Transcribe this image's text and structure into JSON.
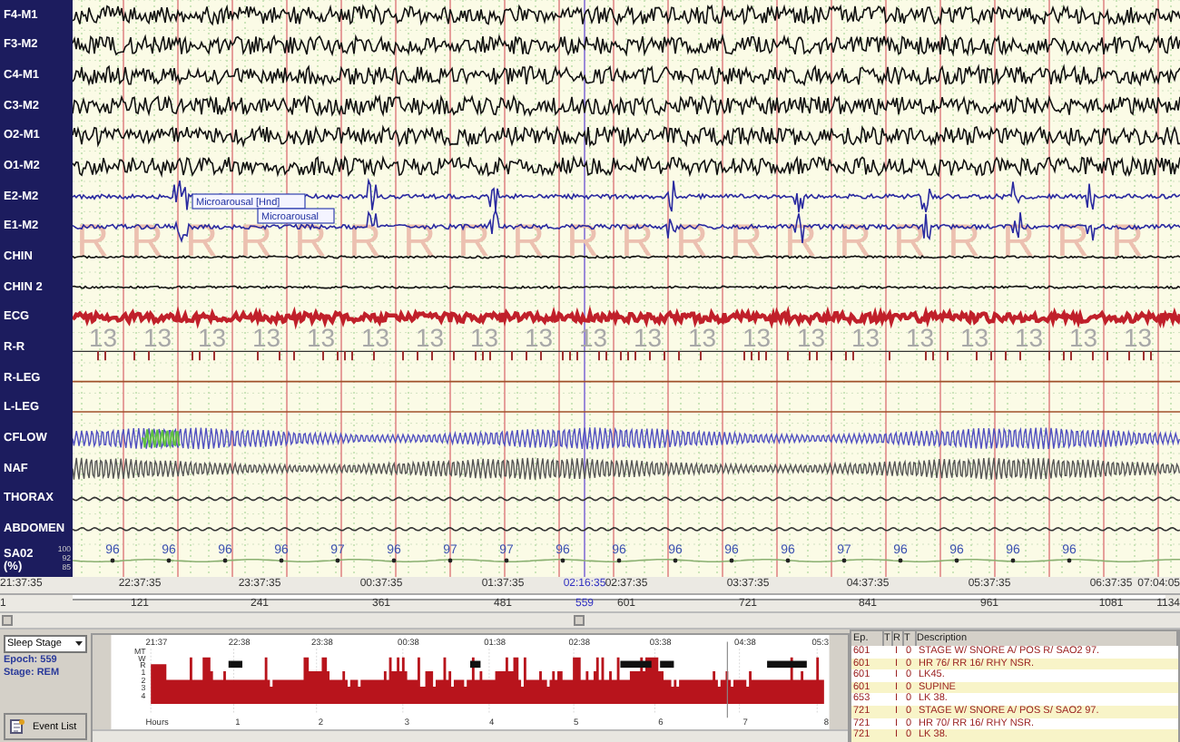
{
  "channels": [
    {
      "label": "F4-M1",
      "kind": "eeg"
    },
    {
      "label": "F3-M2",
      "kind": "eeg"
    },
    {
      "label": "C4-M1",
      "kind": "eeg"
    },
    {
      "label": "C3-M2",
      "kind": "eeg"
    },
    {
      "label": "O2-M1",
      "kind": "eeg"
    },
    {
      "label": "O1-M2",
      "kind": "eeg"
    },
    {
      "label": "E2-M2",
      "kind": "eog"
    },
    {
      "label": "E1-M2",
      "kind": "eog"
    },
    {
      "label": "CHIN",
      "kind": "emg"
    },
    {
      "label": "CHIN 2",
      "kind": "emg"
    },
    {
      "label": "ECG",
      "kind": "ecg"
    },
    {
      "label": "R-R",
      "kind": "rr"
    },
    {
      "label": "R-LEG",
      "kind": "leg"
    },
    {
      "label": "L-LEG",
      "kind": "leg"
    },
    {
      "label": "CFLOW",
      "kind": "flow"
    },
    {
      "label": "NAF",
      "kind": "naf"
    },
    {
      "label": "THORAX",
      "kind": "effort"
    },
    {
      "label": "ABDOMEN",
      "kind": "effort"
    },
    {
      "label": "SA02",
      "unit": "(%)",
      "kind": "spo2",
      "scale": [
        "100",
        "92",
        "85"
      ]
    }
  ],
  "epochs": [
    {
      "stage": "R",
      "rr": "13"
    },
    {
      "stage": "R",
      "rr": "13"
    },
    {
      "stage": "R",
      "rr": "13"
    },
    {
      "stage": "R",
      "rr": "13"
    },
    {
      "stage": "R",
      "rr": "13"
    },
    {
      "stage": "R",
      "rr": "13"
    },
    {
      "stage": "R",
      "rr": "13"
    },
    {
      "stage": "R",
      "rr": "13"
    },
    {
      "stage": "R",
      "rr": "13"
    },
    {
      "stage": "R",
      "rr": "13"
    },
    {
      "stage": "R",
      "rr": "13"
    },
    {
      "stage": "R",
      "rr": "13"
    },
    {
      "stage": "R",
      "rr": "13"
    },
    {
      "stage": "R",
      "rr": "13"
    },
    {
      "stage": "R",
      "rr": "13"
    },
    {
      "stage": "R",
      "rr": "13"
    },
    {
      "stage": "R",
      "rr": "13"
    },
    {
      "stage": "R",
      "rr": "13"
    },
    {
      "stage": "R",
      "rr": "13"
    },
    {
      "stage": "R",
      "rr": "13"
    }
  ],
  "spo2_values": [
    "96",
    "96",
    "96",
    "96",
    "97",
    "96",
    "97",
    "97",
    "96",
    "96",
    "96",
    "96",
    "96",
    "97",
    "96",
    "96",
    "96",
    "96"
  ],
  "events": [
    {
      "label": "Microarousal [Hnd]"
    },
    {
      "label": "Microarousal"
    }
  ],
  "time_axis": [
    {
      "time": "21:37:35",
      "epoch": "1",
      "selected": false
    },
    {
      "time": "22:37:35",
      "epoch": "121",
      "selected": false
    },
    {
      "time": "23:37:35",
      "epoch": "241",
      "selected": false
    },
    {
      "time": "00:37:35",
      "epoch": "361",
      "selected": false
    },
    {
      "time": "01:37:35",
      "epoch": "481",
      "selected": false
    },
    {
      "time": "02:16:35",
      "epoch": "559",
      "selected": true
    },
    {
      "time": "02:37:35",
      "epoch": "601",
      "selected": false
    },
    {
      "time": "03:37:35",
      "epoch": "721",
      "selected": false
    },
    {
      "time": "04:37:35",
      "epoch": "841",
      "selected": false
    },
    {
      "time": "05:37:35",
      "epoch": "961",
      "selected": false
    },
    {
      "time": "06:37:35",
      "epoch": "1081",
      "selected": false
    },
    {
      "time": "07:04:05",
      "epoch": "1134",
      "selected": false
    }
  ],
  "sidebar": {
    "dropdown": "Sleep Stage",
    "epoch": "Epoch: 559",
    "stage": "Stage: REM",
    "event_list_button": "Event List"
  },
  "hypnogram": {
    "stage_labels": [
      "MT",
      "W",
      "R",
      "1",
      "2",
      "3",
      "4"
    ],
    "clock_labels": [
      "21:37",
      "22:38",
      "23:38",
      "00:38",
      "01:38",
      "02:38",
      "03:38",
      "04:38",
      "05:3"
    ],
    "hours_label": "Hours",
    "hours": [
      "1",
      "2",
      "3",
      "4",
      "5",
      "6",
      "7",
      "8"
    ]
  },
  "event_table": {
    "columns": [
      "Ep.",
      "T",
      "R",
      "T",
      "Description"
    ],
    "rows": [
      {
        "ep": "601",
        "flag": "I",
        "value": "0",
        "description": "STAGE W/ SNORE A/ POS R/ SAO2 97."
      },
      {
        "ep": "601",
        "flag": "I",
        "value": "0",
        "description": "HR 76/ RR 16/ RHY NSR."
      },
      {
        "ep": "601",
        "flag": "I",
        "value": "0",
        "description": "LK45."
      },
      {
        "ep": "601",
        "flag": "I",
        "value": "0",
        "description": "SUPINE"
      },
      {
        "ep": "653",
        "flag": "I",
        "value": "0",
        "description": "LK 38."
      },
      {
        "ep": "721",
        "flag": "I",
        "value": "0",
        "description": "STAGE W/ SNORE A/ POS S/ SAO2 97."
      },
      {
        "ep": "721",
        "flag": "I",
        "value": "0",
        "description": "HR 70/ RR 16/ RHY NSR."
      },
      {
        "ep": "721",
        "flag": "I",
        "value": "0",
        "description": "LK 38."
      }
    ]
  }
}
